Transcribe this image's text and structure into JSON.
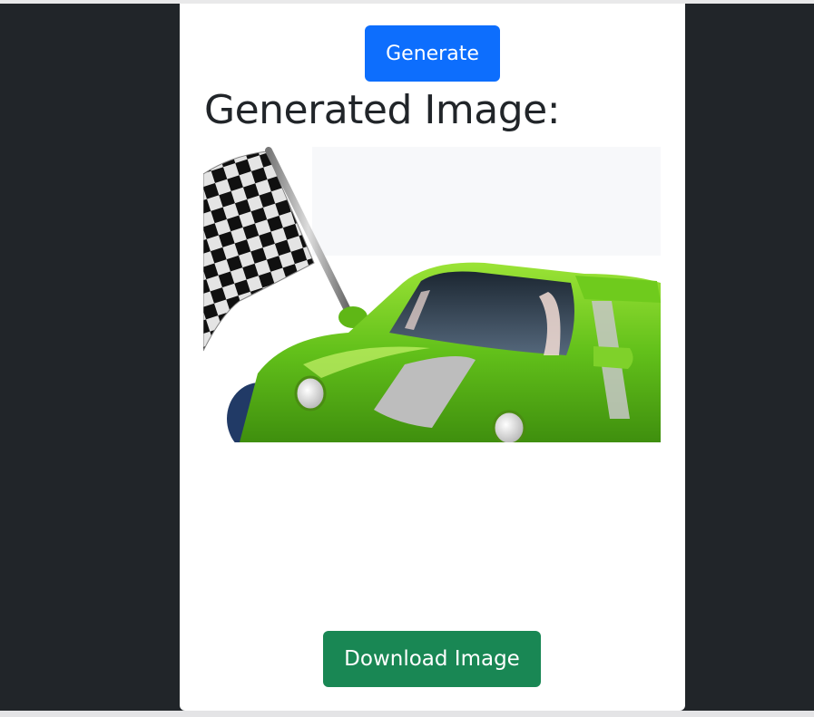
{
  "page": {
    "generate_label": "Generate",
    "heading": "Generated Image:",
    "download_label": "Download Image"
  },
  "image": {
    "subject": "green cartoon race car with checkered flag",
    "flag_colors": [
      "#111111",
      "#f2f2f2"
    ],
    "car_color": "#6cc21a"
  },
  "colors": {
    "background": "#212529",
    "card": "#ffffff",
    "primary_button": "#0d6efd",
    "success_button": "#198754"
  }
}
